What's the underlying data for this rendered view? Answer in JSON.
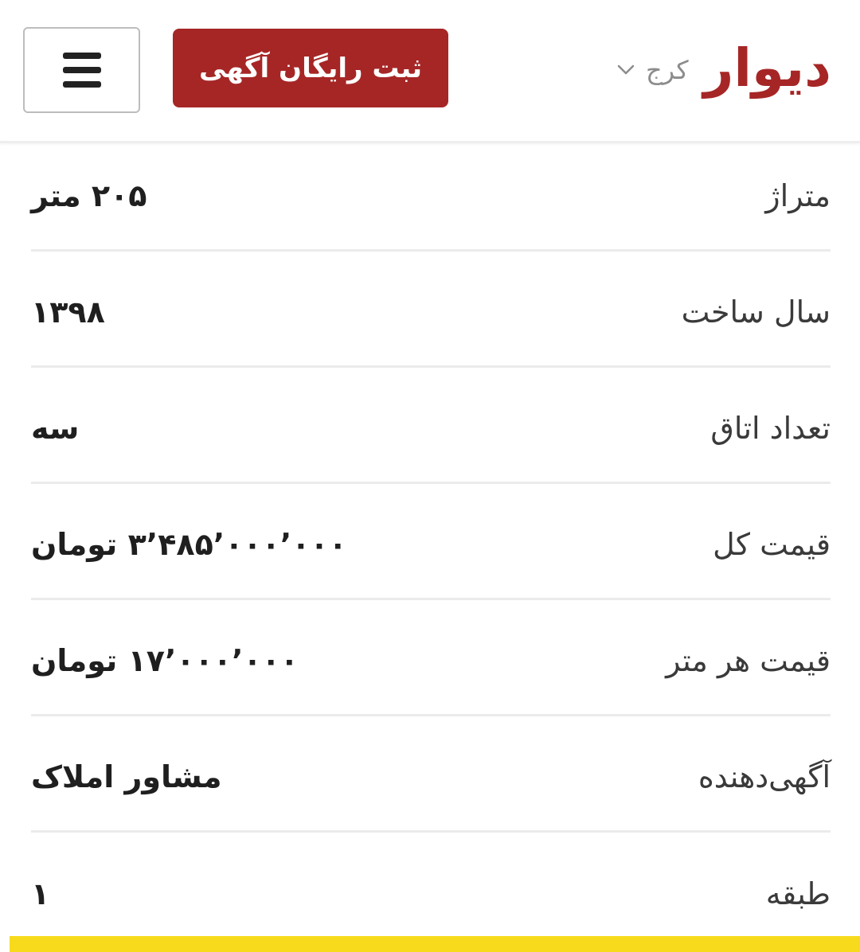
{
  "header": {
    "logo_text": "دیوار",
    "city": "کرج",
    "post_ad_label": "ثبت رایگان آگهی",
    "menu_icon": "hamburger-menu-icon",
    "chevron_icon": "chevron-down-icon"
  },
  "details": [
    {
      "label": "متراژ",
      "value": "۲۰۵ متر"
    },
    {
      "label": "سال ساخت",
      "value": "۱۳۹۸"
    },
    {
      "label": "تعداد اتاق",
      "value": "سه"
    },
    {
      "label": "قیمت کل",
      "value": "۳٬۴۸۵٬۰۰۰٬۰۰۰ تومان"
    },
    {
      "label": "قیمت هر متر",
      "value": "۱۷٬۰۰۰٬۰۰۰ تومان"
    },
    {
      "label": "آگهی‌دهنده",
      "value": "مشاور املاک"
    },
    {
      "label": "طبقه",
      "value": "۱"
    }
  ],
  "colors": {
    "brand_red": "#a62626",
    "accent_yellow": "#f7da1c",
    "divider": "#ebebeb"
  }
}
